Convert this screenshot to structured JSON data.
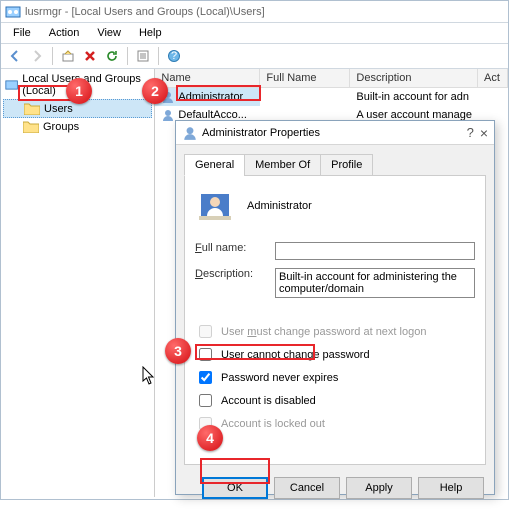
{
  "window": {
    "title": "lusrmgr - [Local Users and Groups (Local)\\Users]"
  },
  "menu": {
    "file": "File",
    "action": "Action",
    "view": "View",
    "help": "Help"
  },
  "tree": {
    "root": "Local Users and Groups (Local)",
    "users": "Users",
    "groups": "Groups"
  },
  "list": {
    "hdr_name": "Name",
    "hdr_full": "Full Name",
    "hdr_desc": "Description",
    "hdr_act": "Act",
    "rows": [
      {
        "name": "Administrator",
        "full": "",
        "desc": "Built-in account for adn"
      },
      {
        "name": "DefaultAcco...",
        "full": "",
        "desc": "A user account manage"
      }
    ]
  },
  "dialog": {
    "title": "Administrator Properties",
    "tabs": {
      "general": "General",
      "member": "Member Of",
      "profile": "Profile"
    },
    "account_name": "Administrator",
    "full_label": "Full name:",
    "full_value": "",
    "desc_label": "Description:",
    "desc_value": "Built-in account for administering the computer/domain",
    "chk_mustchange_pre": "User ",
    "chk_mustchange_u": "m",
    "chk_mustchange_post": "ust change password at next logon",
    "chk_cannot_pre": "User ",
    "chk_cannot_u": "c",
    "chk_cannot_post": "annot change password",
    "chk_never": "Password never expires",
    "chk_disabled": "Account is disabled",
    "chk_locked": "Account is locked out",
    "btn_ok": "OK",
    "btn_cancel": "Cancel",
    "btn_apply": "Apply",
    "btn_help": "Help"
  },
  "badges": {
    "b1": "1",
    "b2": "2",
    "b3": "3",
    "b4": "4"
  }
}
